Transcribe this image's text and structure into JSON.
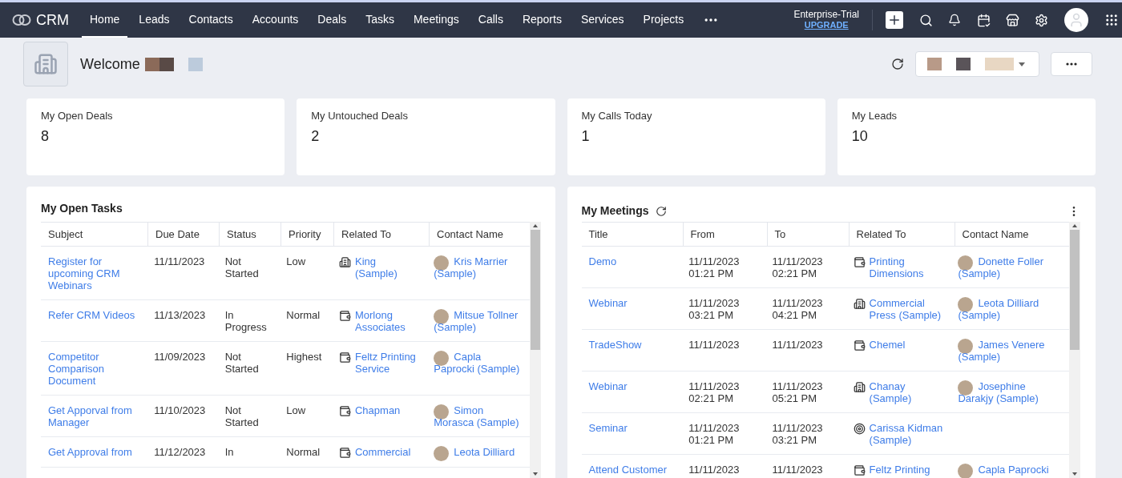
{
  "app": {
    "logo_text": "CRM"
  },
  "nav": [
    {
      "label": "Home",
      "selected": true
    },
    {
      "label": "Leads",
      "selected": false
    },
    {
      "label": "Contacts",
      "selected": false
    },
    {
      "label": "Accounts",
      "selected": false
    },
    {
      "label": "Deals",
      "selected": false
    },
    {
      "label": "Tasks",
      "selected": false
    },
    {
      "label": "Meetings",
      "selected": false
    },
    {
      "label": "Calls",
      "selected": false
    },
    {
      "label": "Reports",
      "selected": false
    },
    {
      "label": "Services",
      "selected": false
    },
    {
      "label": "Projects",
      "selected": false
    }
  ],
  "plan": {
    "name": "Enterprise-Trial",
    "link": "UPGRADE"
  },
  "welcome": {
    "text": "Welcome"
  },
  "stats": [
    {
      "label": "My Open Deals",
      "value": "8"
    },
    {
      "label": "My Untouched Deals",
      "value": "2"
    },
    {
      "label": "My Calls Today",
      "value": "1"
    },
    {
      "label": "My Leads",
      "value": "10"
    }
  ],
  "tasks": {
    "title": "My Open Tasks",
    "columns": [
      "Subject",
      "Due Date",
      "Status",
      "Priority",
      "Related To",
      "Contact Name"
    ],
    "rows": [
      {
        "subject": "Register for upcoming CRM Webinars",
        "due": "11/11/2023",
        "status": "Not Started",
        "priority": "Low",
        "related": {
          "kind": "account",
          "text": "King (Sample)"
        },
        "contact": "Kris Marrier (Sample)"
      },
      {
        "subject": "Refer CRM Videos",
        "due": "11/13/2023",
        "status": "In Progress",
        "priority": "Normal",
        "related": {
          "kind": "deal",
          "text": "Morlong Associates"
        },
        "contact": "Mitsue Tollner (Sample)"
      },
      {
        "subject": "Competitor Comparison Document",
        "due": "11/09/2023",
        "status": "Not Started",
        "priority": "Highest",
        "related": {
          "kind": "deal",
          "text": "Feltz Printing Service"
        },
        "contact": "Capla Paprocki (Sample)"
      },
      {
        "subject": "Get Apporval from Manager",
        "due": "11/10/2023",
        "status": "Not Started",
        "priority": "Low",
        "related": {
          "kind": "deal",
          "text": "Chapman"
        },
        "contact": "Simon Morasca (Sample)"
      },
      {
        "subject": "Get Approval from",
        "due": "11/12/2023",
        "status": "In",
        "priority": "Normal",
        "related": {
          "kind": "deal",
          "text": "Commercial"
        },
        "contact": "Leota Dilliard"
      }
    ]
  },
  "meetings": {
    "title": "My Meetings",
    "columns": [
      "Title",
      "From",
      "To",
      "Related To",
      "Contact Name"
    ],
    "rows": [
      {
        "title": "Demo",
        "from": "11/11/2023 01:21 PM",
        "to": "11/11/2023 02:21 PM",
        "related": {
          "kind": "deal",
          "text": "Printing Dimensions"
        },
        "contact": "Donette Foller (Sample)"
      },
      {
        "title": "Webinar",
        "from": "11/11/2023 03:21 PM",
        "to": "11/11/2023 04:21 PM",
        "related": {
          "kind": "account",
          "text": "Commercial Press (Sample)"
        },
        "contact": "Leota Dilliard (Sample)"
      },
      {
        "title": "TradeShow",
        "from": "11/11/2023",
        "to": "11/11/2023",
        "related": {
          "kind": "deal",
          "text": "Chemel"
        },
        "contact": "James Venere (Sample)"
      },
      {
        "title": "Webinar",
        "from": "11/11/2023 02:21 PM",
        "to": "11/11/2023 05:21 PM",
        "related": {
          "kind": "account",
          "text": "Chanay (Sample)"
        },
        "contact": "Josephine Darakjy (Sample)"
      },
      {
        "title": "Seminar",
        "from": "11/11/2023 01:21 PM",
        "to": "11/11/2023 03:21 PM",
        "related": {
          "kind": "campaign",
          "text": "Carissa Kidman (Sample)"
        }
      },
      {
        "title": "Attend Customer",
        "from": "11/11/2023",
        "to": "11/11/2023",
        "related": {
          "kind": "deal",
          "text": "Feltz Printing"
        },
        "contact": "Capla Paprocki"
      }
    ]
  }
}
